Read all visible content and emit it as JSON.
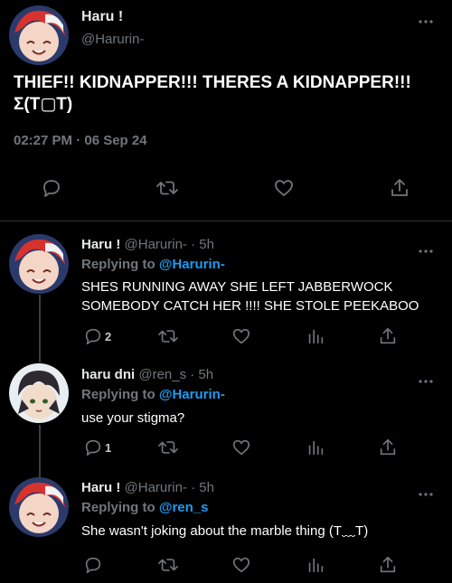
{
  "main_tweet": {
    "display_name": "Haru !",
    "handle": "@Harurin-",
    "text_line1": "THIEF!! KIDNAPPER!!! THERES A KIDNAPPER!!!",
    "text_line2": "Σ(T▢T)",
    "timestamp": "02:27 PM · 06 Sep 24",
    "actions": [
      "reply-icon",
      "retweet-icon",
      "like-icon",
      "share-icon"
    ]
  },
  "replies": [
    {
      "display_name": "Haru !",
      "handle": "@Harurin-",
      "time": "· 5h",
      "replying_label": "Replying to",
      "replying_to": "@Harurin-",
      "text_line1": "SHES RUNNING AWAY SHE LEFT JABBERWOCK",
      "text_line2": "SOMEBODY CATCH HER !!!! SHE STOLE PEEKABOO",
      "reply_count": "2"
    },
    {
      "display_name": "haru dni",
      "handle": "@ren_s",
      "time": "· 5h",
      "replying_label": "Replying to",
      "replying_to": "@Harurin-",
      "text_line1": "use your stigma?",
      "reply_count": "1"
    },
    {
      "display_name": "Haru !",
      "handle": "@Harurin-",
      "time": "· 5h",
      "replying_label": "Replying to",
      "replying_to": "@ren_s",
      "text_line1": "She wasn't joking about the marble thing (T﹏T)",
      "reply_count": ""
    }
  ],
  "colors": {
    "background": "#000000",
    "text": "#e7e9ea",
    "muted": "#71767b",
    "link": "#1d9bf0",
    "divider": "#2f3336"
  }
}
